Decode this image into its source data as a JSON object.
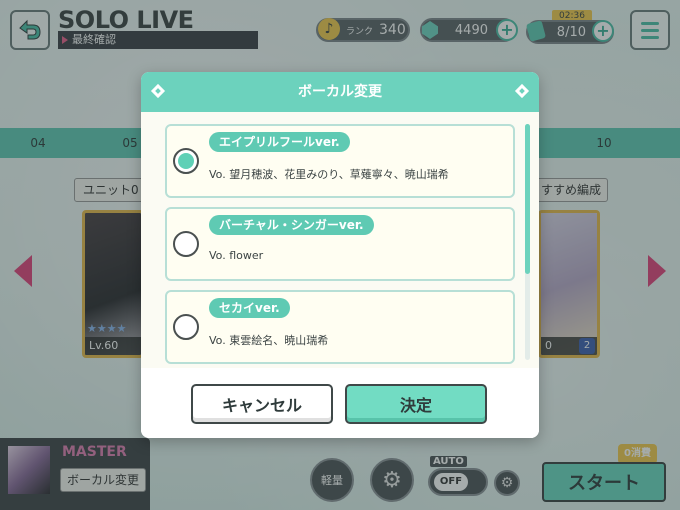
{
  "header": {
    "title": "SOLO LIVE",
    "subtitle": "最終確認",
    "rank_label": "ランク",
    "rank_value": "340",
    "crystals": "4490",
    "stamina_timer": "02:36",
    "stamina": "8/10"
  },
  "background": {
    "tabs": [
      "04",
      "05",
      "10"
    ],
    "unit_label": "ユニット0",
    "recommend_label": "すすめ編成",
    "left_card_level": "Lv.60",
    "right_card_level": "0",
    "right_card_badge": "2"
  },
  "bottom": {
    "difficulty": "MASTER",
    "vocal_change_button": "ボーカル変更",
    "light_label": "軽量",
    "auto_label": "AUTO",
    "auto_state": "OFF",
    "start_label": "スタート",
    "consume_label": "0消費"
  },
  "dialog": {
    "title": "ボーカル変更",
    "options": [
      {
        "tag": "エイプリルフールver.",
        "vo": "Vo. 望月穂波、花里みのり、草薙寧々、暁山瑞希",
        "selected": true
      },
      {
        "tag": "バーチャル・シンガーver.",
        "vo": "Vo. flower",
        "selected": false
      },
      {
        "tag": "セカイver.",
        "vo": "Vo. 東雲絵名、暁山瑞希",
        "selected": false
      }
    ],
    "cancel_label": "キャンセル",
    "confirm_label": "決定"
  },
  "colors": {
    "accent": "#6cd2bd",
    "pink": "#e0427a"
  }
}
